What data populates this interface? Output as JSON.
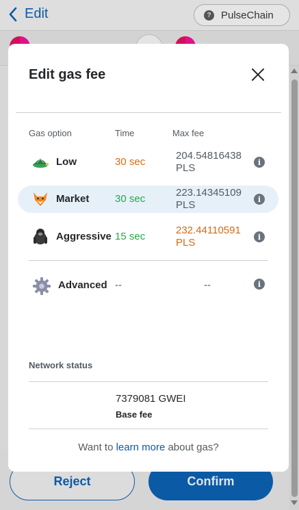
{
  "header": {
    "back_label": "Edit",
    "network": "PulseChain"
  },
  "modal": {
    "title": "Edit gas fee",
    "columns": {
      "option": "Gas option",
      "time": "Time",
      "max_fee": "Max fee"
    },
    "options": [
      {
        "name": "Low",
        "time": "30 sec",
        "fee_line1": "204.54816438",
        "fee_line2": "PLS",
        "time_color": "#d66a13",
        "fee_color": "#535a61"
      },
      {
        "name": "Market",
        "time": "30 sec",
        "fee_line1": "223.14345109",
        "fee_line2": "PLS",
        "time_color": "#28a745",
        "fee_color": "#535a61"
      },
      {
        "name": "Aggressive",
        "time": "15 sec",
        "fee_line1": "232.44110591",
        "fee_line2": "PLS",
        "time_color": "#28a745",
        "fee_color": "#d66a13"
      }
    ],
    "advanced": {
      "name": "Advanced",
      "time": "--",
      "fee": "--"
    },
    "network_status": {
      "label": "Network status",
      "base_fee_value": "7379081 GWEI",
      "base_fee_label": "Base fee"
    },
    "footer": {
      "prefix": "Want to ",
      "link": "learn more",
      "suffix": " about gas?"
    }
  },
  "actions": {
    "reject": "Reject",
    "confirm": "Confirm"
  },
  "colors": {
    "accent": "#0b5aa6",
    "selected_row": "#e6f0f9",
    "orange": "#d66a13",
    "green": "#28a745"
  }
}
